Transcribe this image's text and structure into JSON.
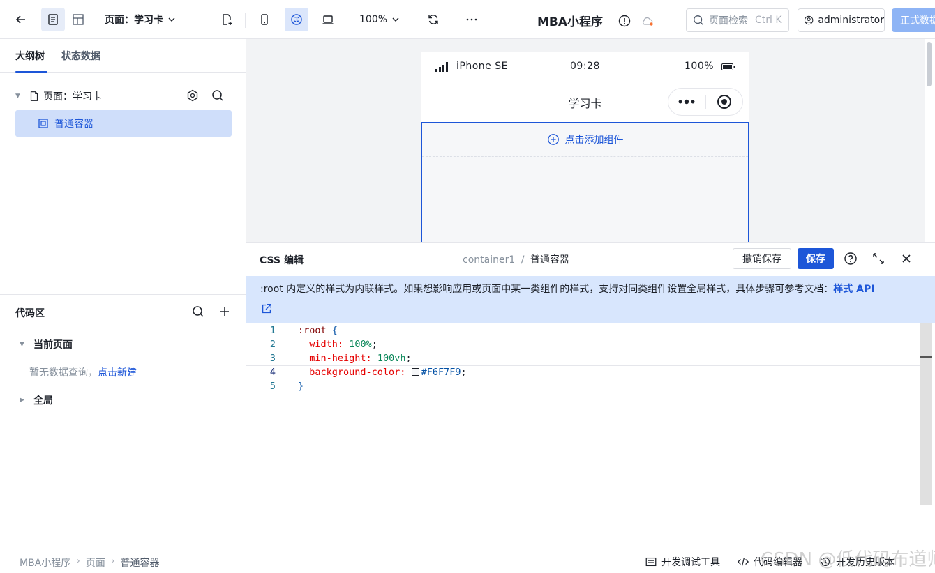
{
  "topbar": {
    "page_select": "页面：学习卡",
    "zoom": "100%",
    "app_title": "MBA小程序",
    "search_placeholder": "页面检索",
    "search_shortcut": "Ctrl K",
    "user": "administrator",
    "publish": "正式数据"
  },
  "left": {
    "tabs": [
      "大纲树",
      "状态数据"
    ],
    "tree": {
      "page_label": "页面：学习卡",
      "container_label": "普通容器"
    },
    "code_area": {
      "title": "代码区",
      "current_page": "当前页面",
      "empty_text": "暂无数据查询，",
      "empty_link": "点击新建",
      "global": "全局"
    }
  },
  "phone": {
    "carrier": "iPhone SE",
    "time": "09:28",
    "battery": "100%",
    "nav_title": "学习卡",
    "add_component": "点击添加组件"
  },
  "css_panel": {
    "title": "CSS 编辑",
    "crumb_parent": "container1",
    "crumb_sep": "/",
    "crumb_current": "普通容器",
    "undo": "撤销保存",
    "save": "保存",
    "notice": ":root 内定义的样式为内联样式。如果想影响应用或页面中某一类组件的样式，支持对同类组件设置全局样式，具体步骤可参考文档：",
    "notice_link": "样式 API",
    "code": {
      "line_numbers": [
        "1",
        "2",
        "3",
        "4",
        "5"
      ],
      "selector": ":root",
      "open_brace": "{",
      "close_brace": "}",
      "props": [
        {
          "name": "width:",
          "value": "100%"
        },
        {
          "name": "min-height:",
          "value": "100vh"
        },
        {
          "name": "background-color:",
          "value": "#F6F7F9"
        }
      ]
    }
  },
  "footer": {
    "crumbs": [
      "MBA小程序",
      "页面",
      "普通容器"
    ],
    "dev_tools": "开发调试工具",
    "code_editor": "代码编辑器",
    "history": "开发历史版本"
  },
  "watermark": "CSDN @低代码布道师",
  "colors": {
    "accent": "#1d56d8",
    "notice_bg": "#d8e6fd",
    "selected_bg": "#cfdefa",
    "canvas_bg": "#f2f3f5"
  }
}
